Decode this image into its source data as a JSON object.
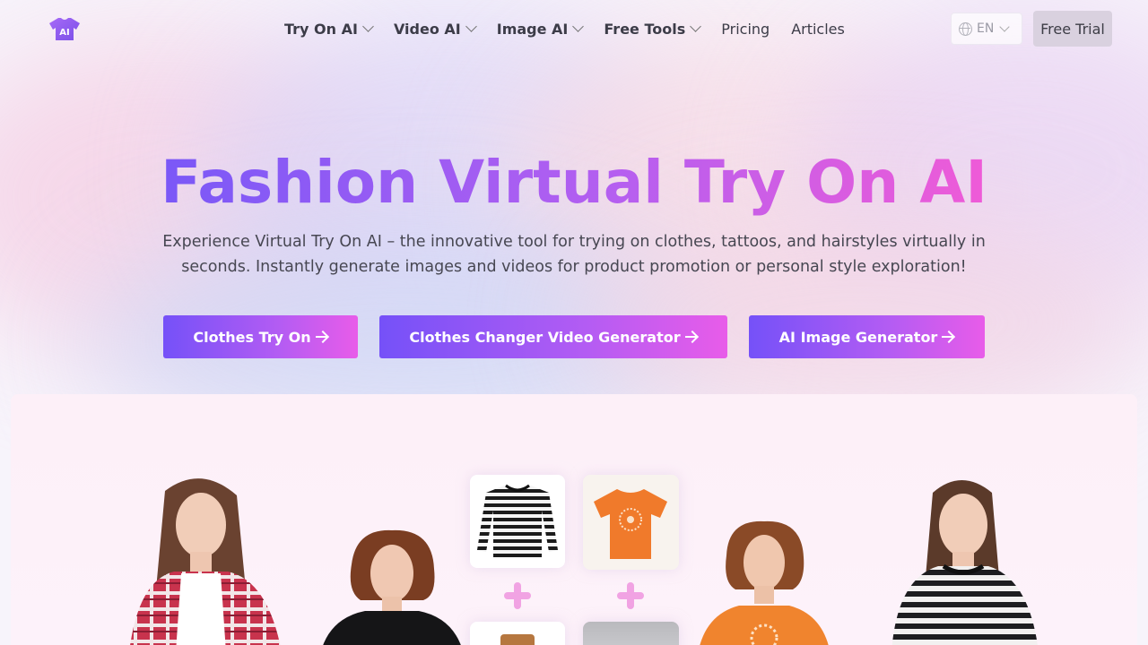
{
  "nav": {
    "logo_text": "AI",
    "items": [
      {
        "label": "Try On AI",
        "dropdown": true
      },
      {
        "label": "Video AI",
        "dropdown": true
      },
      {
        "label": "Image AI",
        "dropdown": true
      },
      {
        "label": "Free Tools",
        "dropdown": true
      },
      {
        "label": "Pricing",
        "dropdown": false
      },
      {
        "label": "Articles",
        "dropdown": false
      }
    ],
    "language": "EN",
    "trial_label": "Free Trial"
  },
  "hero": {
    "title": "Fashion Virtual Try On AI",
    "subtitle": "Experience Virtual Try On AI – the innovative tool for trying on clothes, tattoos, and hairstyles virtually in seconds. Instantly generate images and videos for product promotion or personal style exploration!",
    "buttons": [
      {
        "label": "Clothes Try On"
      },
      {
        "label": "Clothes Changer Video Generator"
      },
      {
        "label": "AI Image Generator"
      }
    ]
  },
  "colors": {
    "gradient_start": "#7a58f7",
    "gradient_end": "#ef5bd7",
    "trial_bg": "#d9d1df"
  }
}
